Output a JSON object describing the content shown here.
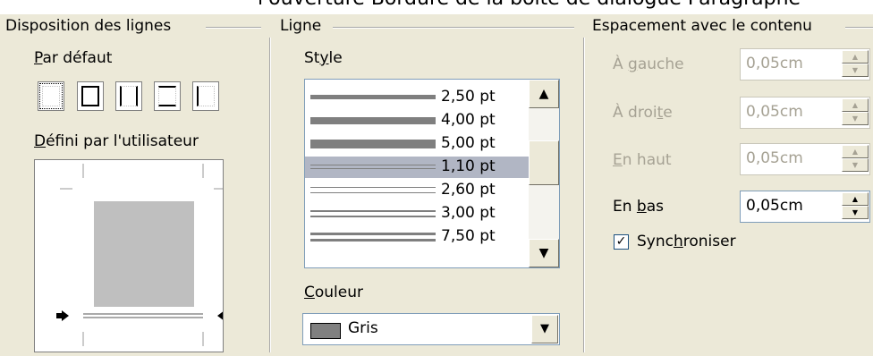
{
  "header_cut_text": "l'ouverture Bordure de la boîte de dialogue Paragraphe",
  "groups": {
    "disposition": "Disposition des lignes",
    "ligne": "Ligne",
    "espacement": "Espacement avec le contenu"
  },
  "disposition": {
    "par_defaut_label": "Par défaut",
    "defini_label": "Défini par l'utilisateur"
  },
  "ligne": {
    "style_label": "Style",
    "styles": [
      {
        "label": "2,50 pt",
        "kind": "single"
      },
      {
        "label": "4,00 pt",
        "kind": "single"
      },
      {
        "label": "5,00 pt",
        "kind": "single"
      },
      {
        "label": "1,10 pt",
        "kind": "double",
        "selected": true
      },
      {
        "label": "2,60 pt",
        "kind": "double"
      },
      {
        "label": "3,00 pt",
        "kind": "double"
      },
      {
        "label": "7,50 pt",
        "kind": "double"
      }
    ],
    "couleur_label": "Couleur",
    "couleur_value": "Gris",
    "couleur_hex": "#808080"
  },
  "espacement": {
    "gauche": {
      "label": "À gauche",
      "value": "0,05cm",
      "enabled": false
    },
    "droite": {
      "label": "À droite",
      "value": "0,05cm",
      "enabled": false
    },
    "haut": {
      "label": "En haut",
      "value": "0,05cm",
      "enabled": false
    },
    "bas": {
      "label": "En bas",
      "value": "0,05cm",
      "enabled": true
    },
    "synchroniser_label": "Synchroniser",
    "synchroniser_checked": true
  }
}
